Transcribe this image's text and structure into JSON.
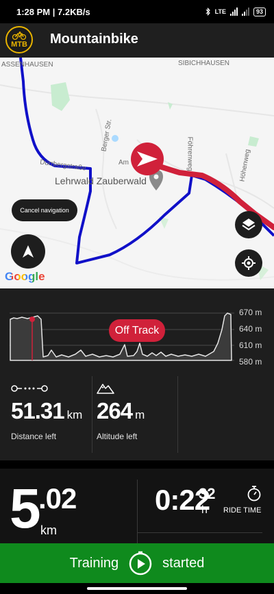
{
  "status": {
    "time": "1:28 PM",
    "speed": "7.2KB/s",
    "network": "LTE",
    "battery": "93"
  },
  "app": {
    "logo": "MTB",
    "title": "Mountainbike"
  },
  "map": {
    "places": {
      "assenhausen": "ASSENHAUSEN",
      "sibichhausen": "SIBICHHAUSEN",
      "berger": "Berger Str.",
      "fohrenweg": "Föhrenweg",
      "hohenweg": "Höhenweg",
      "am": "Am",
      "durrberg": "Dürrbergstraße",
      "lehrwald": "Lehrwald Zauberwald"
    },
    "cancel_navigation": "Cancel navigation",
    "attribution": "Google",
    "colors": {
      "route": "#1010c8",
      "track": "#d0213a"
    },
    "icons": {
      "nav": "navigation-arrow-icon",
      "layers": "layers-icon",
      "locate": "gps-target-icon",
      "marker": "position-marker-icon"
    }
  },
  "elevation": {
    "ticks": [
      "670 m",
      "640 m",
      "610 m",
      "580 m"
    ],
    "status": "Off Track"
  },
  "stats": {
    "distance": {
      "value": "51.31",
      "unit": "km",
      "label": "Distance left",
      "icon": "route-dots-icon"
    },
    "altitude": {
      "value": "264",
      "unit": "m",
      "label": "Altitude left",
      "icon": "mountain-icon"
    }
  },
  "metrics": {
    "speed_int": "5",
    "speed_dec": ".02",
    "speed_unit": "km",
    "time_main": "0:22",
    "time_sec": "32",
    "time_unit": "h",
    "time_label": "RIDE TIME"
  },
  "training": {
    "left": "Training",
    "right": "started",
    "color": "#0f8a1d"
  }
}
